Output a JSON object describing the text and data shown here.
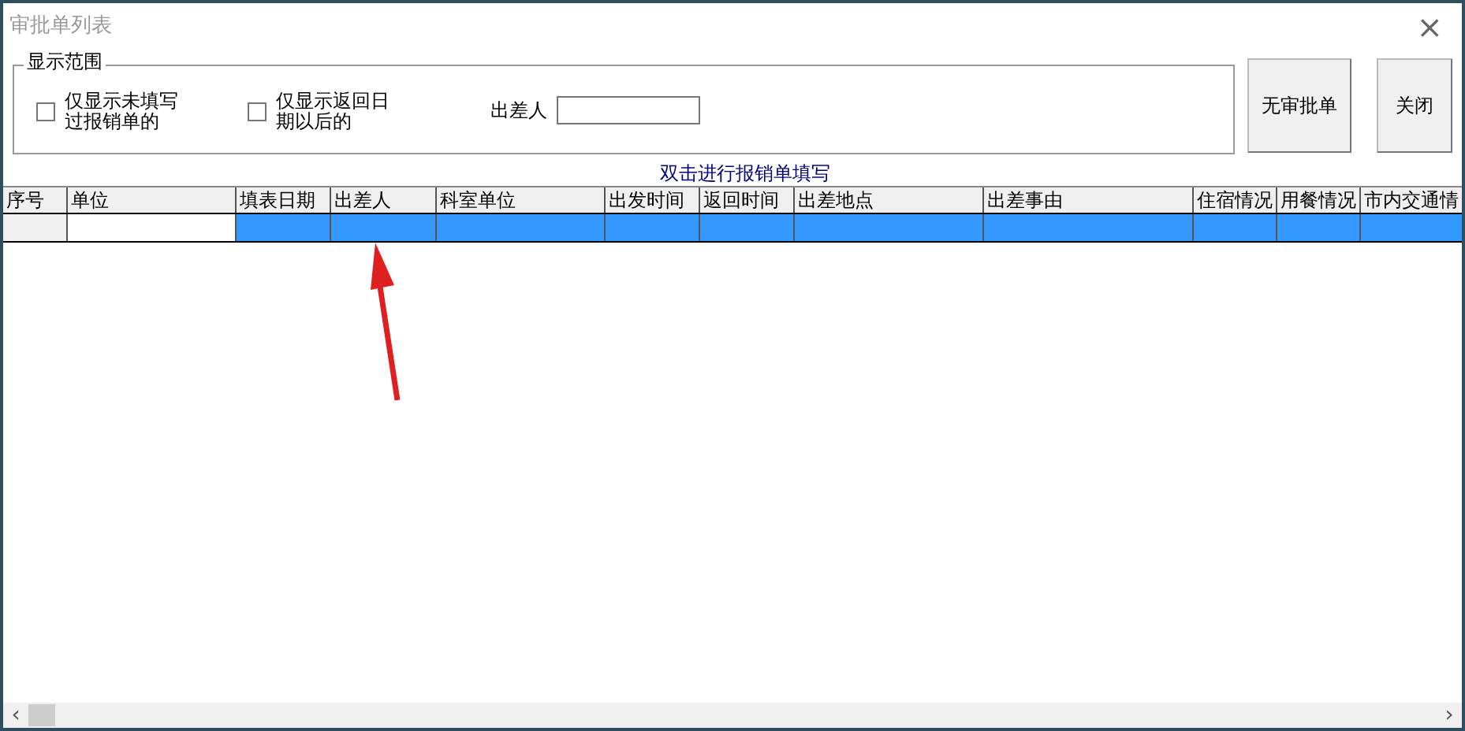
{
  "window": {
    "title": "审批单列表",
    "close": "×"
  },
  "filter": {
    "legend": "显示范围",
    "checkboxes": [
      {
        "label": "仅显示未填写过报销单的",
        "checked": false
      },
      {
        "label": "仅显示返回日期以后的",
        "checked": false
      }
    ],
    "traveler": {
      "label": "出差人"
    }
  },
  "buttons": [
    "无审批单",
    "关闭"
  ],
  "hint": "双击进行报销单填写",
  "table": {
    "columns": [
      "序号",
      "单位",
      "填表日期",
      "出差人",
      "科室单位",
      "出发时间",
      "返回时间",
      "出差地点",
      "出差事由",
      "住宿情况",
      "用餐情况",
      "市内交通情"
    ],
    "rows": [
      {
        "selected": true
      }
    ]
  },
  "scrollbar": {
    "left": "‹",
    "right": "›"
  }
}
